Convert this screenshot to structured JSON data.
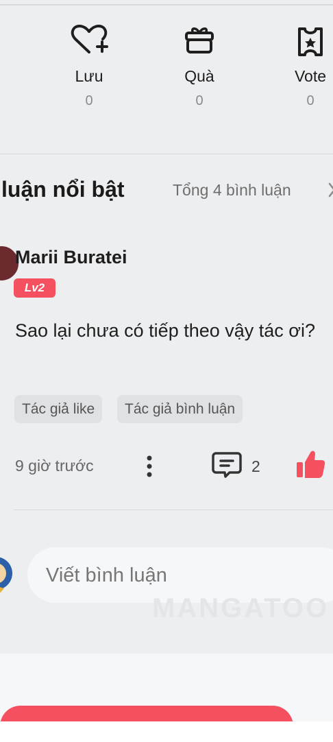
{
  "actions": {
    "save": {
      "label": "Lưu",
      "count": "0",
      "icon": "heart-plus-icon"
    },
    "gift": {
      "label": "Quà",
      "count": "0",
      "icon": "gift-icon"
    },
    "vote": {
      "label": "Vote",
      "count": "0",
      "icon": "ticket-star-icon"
    }
  },
  "comments_section": {
    "title": "luận nổi bật",
    "total": "Tổng 4 bình luận",
    "chevron_icon": "chevron-right-icon"
  },
  "comment": {
    "username": "Marii Buratei",
    "level": "Lv2",
    "text": "Sao lại chưa có tiếp theo vậy tác ơi?",
    "tags": [
      "Tác giả like",
      "Tác giả bình luận"
    ],
    "time": "9 giờ trước",
    "reply_count": "2",
    "more_icon": "more-vertical-icon",
    "reply_icon": "comment-icon",
    "like_icon": "thumbs-up-icon"
  },
  "composer": {
    "placeholder": "Viết bình luận",
    "watermark": "MANGATOO"
  },
  "colors": {
    "accent": "#f4505f",
    "background": "#edeef0",
    "input_bg": "#f6f7f8",
    "muted_text": "#6e6e6e"
  }
}
